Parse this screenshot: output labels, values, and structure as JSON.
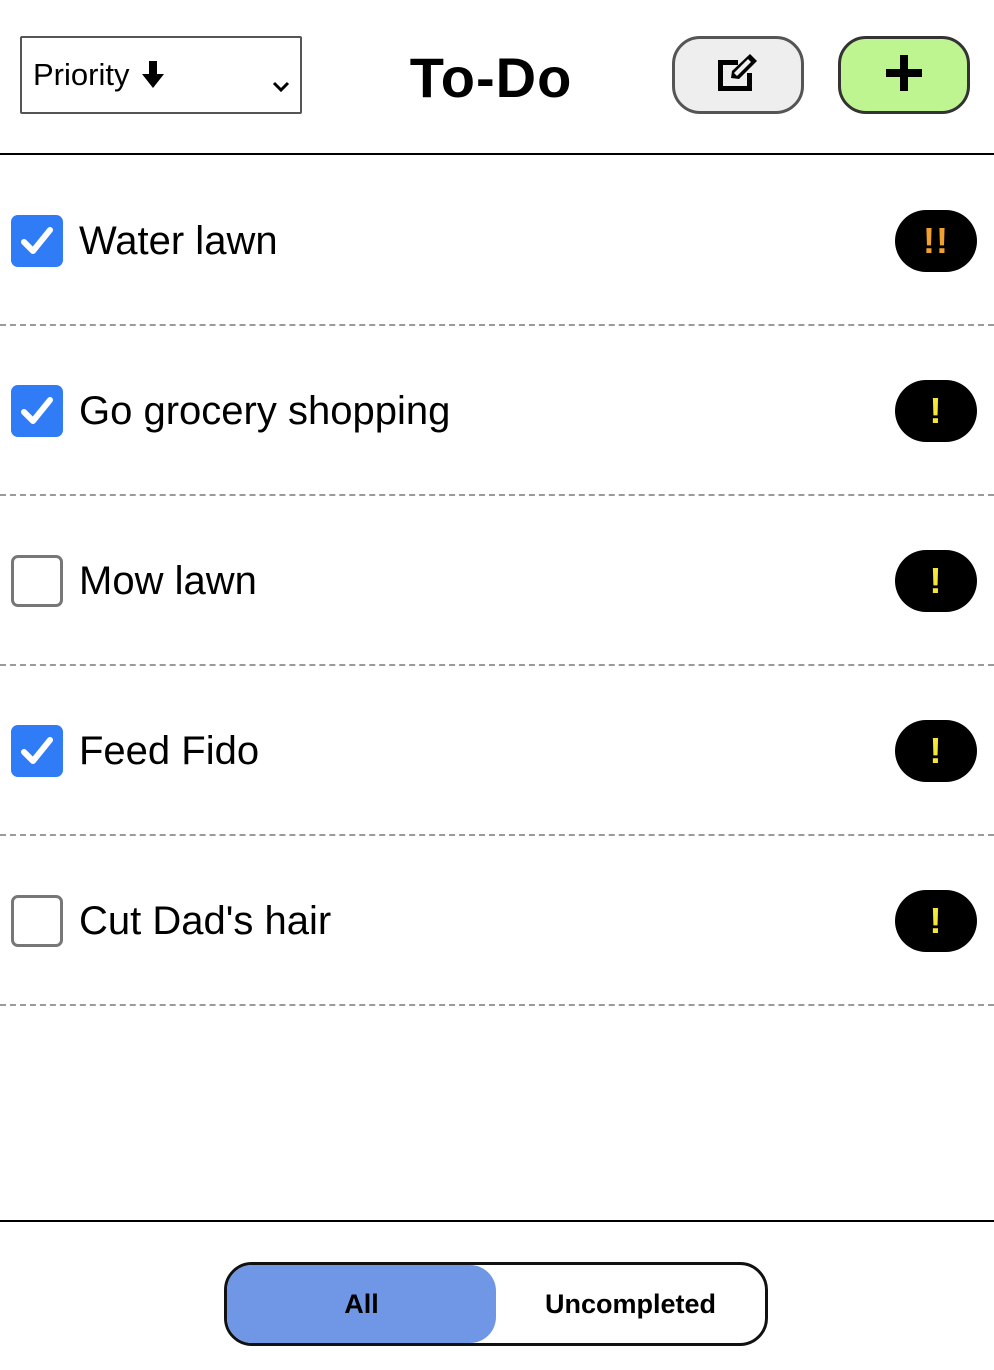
{
  "header": {
    "sort_label": "Priority",
    "title": "To-Do",
    "edit_icon": "edit-square-icon",
    "add_icon": "plus-icon"
  },
  "todos": [
    {
      "label": "Water lawn",
      "completed": true,
      "priority": "!!",
      "priority_color": "#f0a030"
    },
    {
      "label": "Go grocery shopping",
      "completed": true,
      "priority": "!",
      "priority_color": "#f5e63a"
    },
    {
      "label": "Mow lawn",
      "completed": false,
      "priority": "!",
      "priority_color": "#f5e63a"
    },
    {
      "label": "Feed Fido",
      "completed": true,
      "priority": "!",
      "priority_color": "#f5e63a"
    },
    {
      "label": "Cut Dad's hair",
      "completed": false,
      "priority": "!",
      "priority_color": "#f5e63a"
    }
  ],
  "filter": {
    "options": [
      "All",
      "Uncompleted"
    ],
    "selected": "All"
  },
  "colors": {
    "checkbox_checked": "#2f7cf6",
    "add_button": "#bef590",
    "edit_button": "#eeeeee",
    "filter_active": "#7097e6"
  }
}
